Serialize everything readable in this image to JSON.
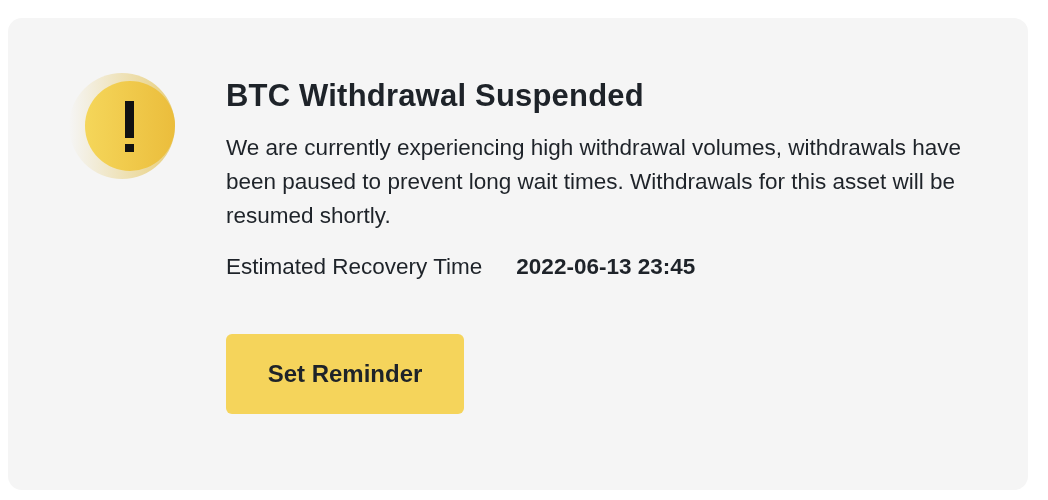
{
  "notice": {
    "title": "BTC Withdrawal Suspended",
    "message": "We are currently experiencing high withdrawal volumes, withdrawals have been paused to prevent long wait times. Withdrawals for this asset will be resumed shortly.",
    "recovery_label": "Estimated Recovery Time",
    "recovery_time": "2022-06-13 23:45",
    "button": "Set Reminder"
  }
}
